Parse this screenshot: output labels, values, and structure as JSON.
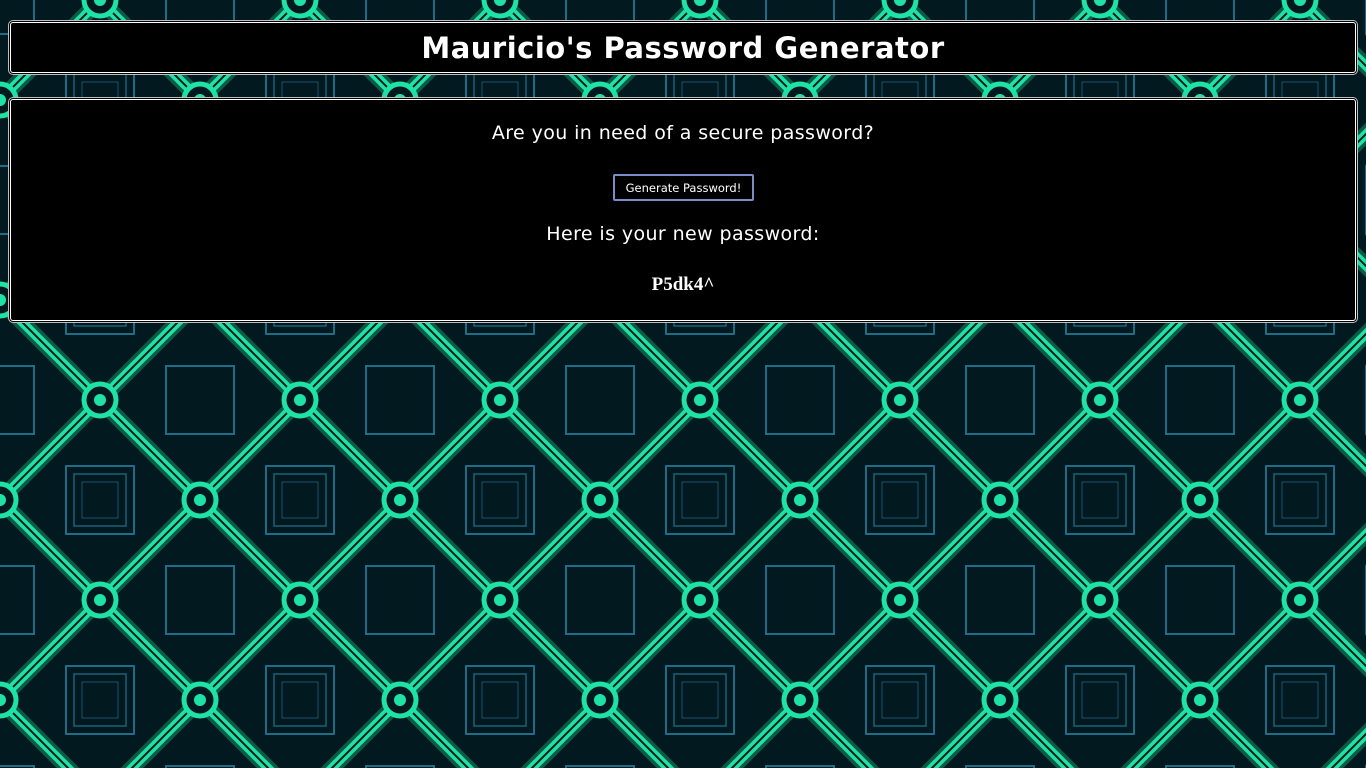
{
  "page": {
    "title": "Mauricio's Password Generator"
  },
  "main": {
    "question": "Are you in need of a secure password?",
    "generate_button_label": "Generate Password!",
    "result_label": "Here is your new password:",
    "password": "P5dk4^"
  },
  "colors": {
    "background_dark": "#02191f",
    "neon_green": "#1ee3a4",
    "grid_blue": "#2a8fb8",
    "panel_background": "#000000",
    "panel_border": "#ffffff",
    "button_border": "#7a8dc7"
  }
}
